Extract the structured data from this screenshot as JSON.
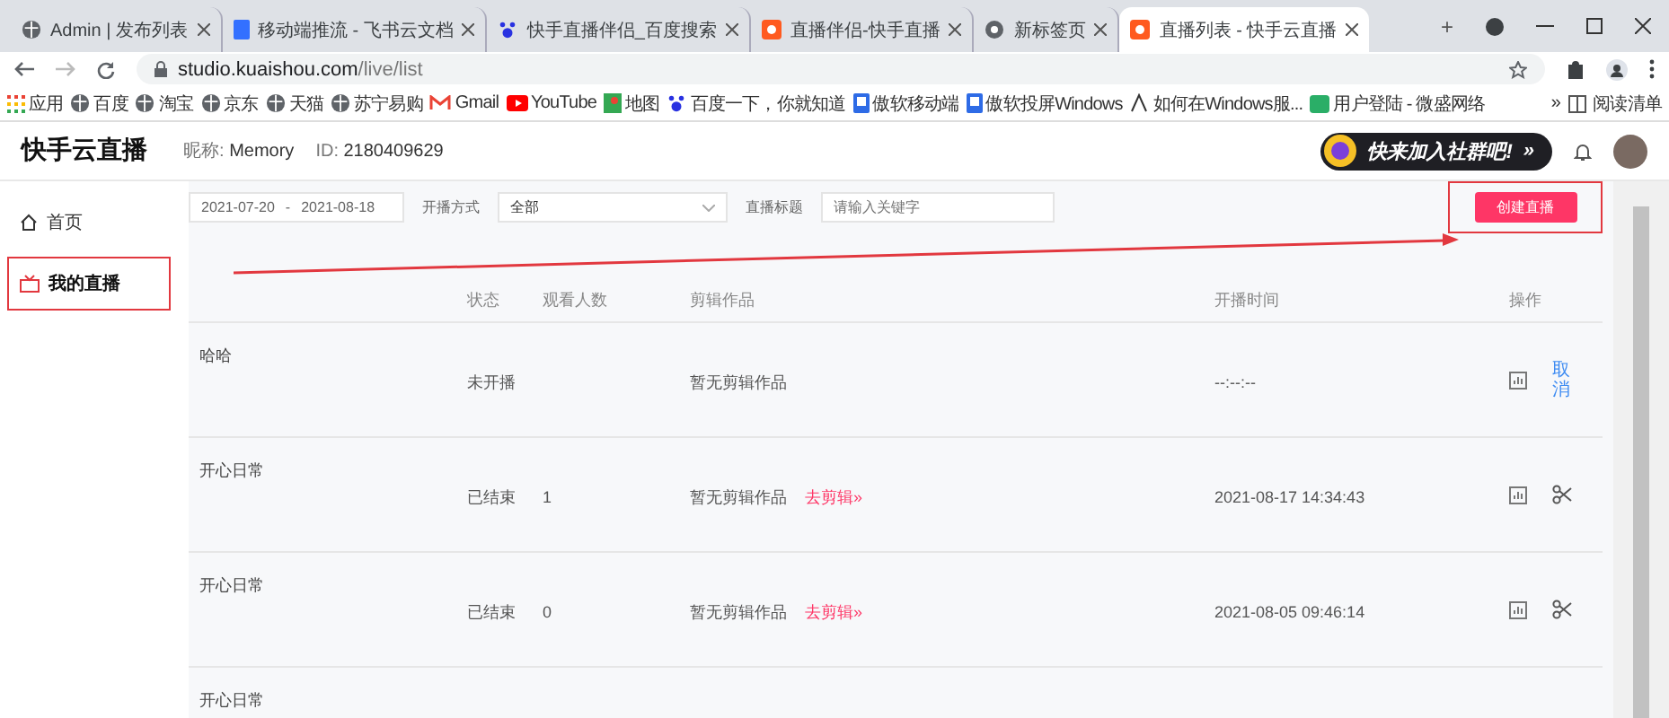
{
  "browser": {
    "tabs": [
      {
        "title": "Admin | 发布列表",
        "kind": "globe",
        "selected": false
      },
      {
        "title": "移动端推流 - 飞书云文档",
        "kind": "doc",
        "selected": false
      },
      {
        "title": "快手直播伴侣_百度搜索",
        "kind": "paw",
        "selected": false
      },
      {
        "title": "直播伴侣-快手直播",
        "kind": "app",
        "selected": false
      },
      {
        "title": "新标签页",
        "kind": "chrome",
        "selected": false
      },
      {
        "title": "直播列表 - 快手云直播",
        "kind": "app",
        "selected": true
      }
    ],
    "new_tab": "+",
    "url_host": "studio.kuaishou.com",
    "url_path": "/live/list",
    "bookmarks": [
      {
        "label": "应用",
        "kind": "grid"
      },
      {
        "label": "百度",
        "kind": "globe"
      },
      {
        "label": "淘宝",
        "kind": "globe"
      },
      {
        "label": "京东",
        "kind": "globe"
      },
      {
        "label": "天猫",
        "kind": "globe"
      },
      {
        "label": "苏宁易购",
        "kind": "globe"
      },
      {
        "label": "Gmail",
        "kind": "mail"
      },
      {
        "label": "YouTube",
        "kind": "play"
      },
      {
        "label": "地图",
        "kind": "map"
      },
      {
        "label": "百度一下，你就知道",
        "kind": "paw"
      },
      {
        "label": "傲软移动端",
        "kind": "phone"
      },
      {
        "label": "傲软投屏Windows",
        "kind": "phone"
      },
      {
        "label": "如何在Windows服...",
        "kind": "letter"
      },
      {
        "label": "用户登陆 - 微盛网络",
        "kind": "chat"
      }
    ],
    "bookmarks_more": "»",
    "reading_list": "阅读清单"
  },
  "header": {
    "logo": "快手云直播",
    "nickname_label": "昵称:",
    "nickname": "Memory",
    "id_label": "ID:",
    "id": "2180409629",
    "banner": "快来加入社群吧!",
    "banner_more": "»"
  },
  "sidebar": {
    "items": [
      {
        "label": "首页",
        "kind": "home",
        "selected": false,
        "highlighted": false
      },
      {
        "label": "我的直播",
        "kind": "tv",
        "selected": true,
        "highlighted": true
      }
    ]
  },
  "filters": {
    "date_start": "2021-07-20",
    "date_separator": "-",
    "date_end": "2021-08-18",
    "mode_label": "开播方式",
    "mode_value": "全部",
    "title_label": "直播标题",
    "title_placeholder": "请输入关键字",
    "create_button": "创建直播",
    "create_highlighted": true,
    "arrow": true
  },
  "table": {
    "columns": [
      "状态",
      "观看人数",
      "剪辑作品",
      "开播时间",
      "操作"
    ],
    "rows": [
      {
        "title": "哈哈",
        "status": "未开播",
        "viewers": "",
        "clips": "暂无剪辑作品",
        "edit_link": "",
        "start_time": "--:--:--",
        "actions": [
          {
            "kind": "chart"
          },
          {
            "kind": "text",
            "label": "取消"
          }
        ]
      },
      {
        "title": "开心日常",
        "status": "已结束",
        "viewers": "1",
        "clips": "暂无剪辑作品",
        "edit_link": "去剪辑»",
        "start_time": "2021-08-17 14:34:43",
        "actions": [
          {
            "kind": "chart"
          },
          {
            "kind": "scissors"
          }
        ]
      },
      {
        "title": "开心日常",
        "status": "已结束",
        "viewers": "0",
        "clips": "暂无剪辑作品",
        "edit_link": "去剪辑»",
        "start_time": "2021-08-05 09:46:14",
        "actions": [
          {
            "kind": "chart"
          },
          {
            "kind": "scissors"
          }
        ]
      },
      {
        "title": "开心日常",
        "status": "",
        "viewers": "",
        "clips": "",
        "edit_link": "",
        "start_time": "",
        "actions": []
      }
    ]
  }
}
